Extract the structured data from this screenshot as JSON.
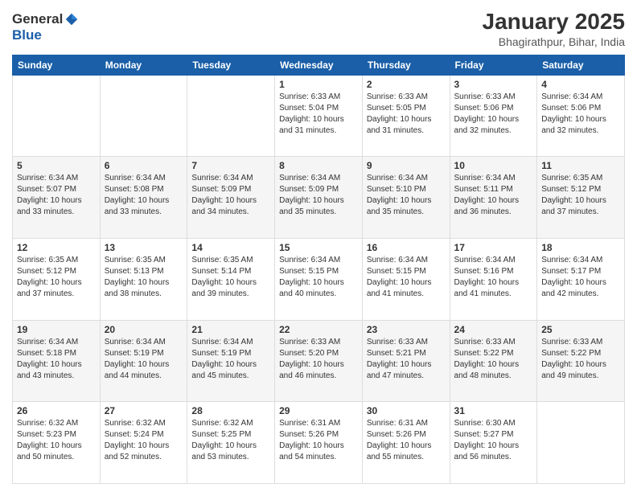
{
  "header": {
    "logo_line1": "General",
    "logo_line2": "Blue",
    "title": "January 2025",
    "subtitle": "Bhagirathpur, Bihar, India"
  },
  "weekdays": [
    "Sunday",
    "Monday",
    "Tuesday",
    "Wednesday",
    "Thursday",
    "Friday",
    "Saturday"
  ],
  "weeks": [
    [
      {
        "num": "",
        "info": ""
      },
      {
        "num": "",
        "info": ""
      },
      {
        "num": "",
        "info": ""
      },
      {
        "num": "1",
        "info": "Sunrise: 6:33 AM\nSunset: 5:04 PM\nDaylight: 10 hours\nand 31 minutes."
      },
      {
        "num": "2",
        "info": "Sunrise: 6:33 AM\nSunset: 5:05 PM\nDaylight: 10 hours\nand 31 minutes."
      },
      {
        "num": "3",
        "info": "Sunrise: 6:33 AM\nSunset: 5:06 PM\nDaylight: 10 hours\nand 32 minutes."
      },
      {
        "num": "4",
        "info": "Sunrise: 6:34 AM\nSunset: 5:06 PM\nDaylight: 10 hours\nand 32 minutes."
      }
    ],
    [
      {
        "num": "5",
        "info": "Sunrise: 6:34 AM\nSunset: 5:07 PM\nDaylight: 10 hours\nand 33 minutes."
      },
      {
        "num": "6",
        "info": "Sunrise: 6:34 AM\nSunset: 5:08 PM\nDaylight: 10 hours\nand 33 minutes."
      },
      {
        "num": "7",
        "info": "Sunrise: 6:34 AM\nSunset: 5:09 PM\nDaylight: 10 hours\nand 34 minutes."
      },
      {
        "num": "8",
        "info": "Sunrise: 6:34 AM\nSunset: 5:09 PM\nDaylight: 10 hours\nand 35 minutes."
      },
      {
        "num": "9",
        "info": "Sunrise: 6:34 AM\nSunset: 5:10 PM\nDaylight: 10 hours\nand 35 minutes."
      },
      {
        "num": "10",
        "info": "Sunrise: 6:34 AM\nSunset: 5:11 PM\nDaylight: 10 hours\nand 36 minutes."
      },
      {
        "num": "11",
        "info": "Sunrise: 6:35 AM\nSunset: 5:12 PM\nDaylight: 10 hours\nand 37 minutes."
      }
    ],
    [
      {
        "num": "12",
        "info": "Sunrise: 6:35 AM\nSunset: 5:12 PM\nDaylight: 10 hours\nand 37 minutes."
      },
      {
        "num": "13",
        "info": "Sunrise: 6:35 AM\nSunset: 5:13 PM\nDaylight: 10 hours\nand 38 minutes."
      },
      {
        "num": "14",
        "info": "Sunrise: 6:35 AM\nSunset: 5:14 PM\nDaylight: 10 hours\nand 39 minutes."
      },
      {
        "num": "15",
        "info": "Sunrise: 6:34 AM\nSunset: 5:15 PM\nDaylight: 10 hours\nand 40 minutes."
      },
      {
        "num": "16",
        "info": "Sunrise: 6:34 AM\nSunset: 5:15 PM\nDaylight: 10 hours\nand 41 minutes."
      },
      {
        "num": "17",
        "info": "Sunrise: 6:34 AM\nSunset: 5:16 PM\nDaylight: 10 hours\nand 41 minutes."
      },
      {
        "num": "18",
        "info": "Sunrise: 6:34 AM\nSunset: 5:17 PM\nDaylight: 10 hours\nand 42 minutes."
      }
    ],
    [
      {
        "num": "19",
        "info": "Sunrise: 6:34 AM\nSunset: 5:18 PM\nDaylight: 10 hours\nand 43 minutes."
      },
      {
        "num": "20",
        "info": "Sunrise: 6:34 AM\nSunset: 5:19 PM\nDaylight: 10 hours\nand 44 minutes."
      },
      {
        "num": "21",
        "info": "Sunrise: 6:34 AM\nSunset: 5:19 PM\nDaylight: 10 hours\nand 45 minutes."
      },
      {
        "num": "22",
        "info": "Sunrise: 6:33 AM\nSunset: 5:20 PM\nDaylight: 10 hours\nand 46 minutes."
      },
      {
        "num": "23",
        "info": "Sunrise: 6:33 AM\nSunset: 5:21 PM\nDaylight: 10 hours\nand 47 minutes."
      },
      {
        "num": "24",
        "info": "Sunrise: 6:33 AM\nSunset: 5:22 PM\nDaylight: 10 hours\nand 48 minutes."
      },
      {
        "num": "25",
        "info": "Sunrise: 6:33 AM\nSunset: 5:22 PM\nDaylight: 10 hours\nand 49 minutes."
      }
    ],
    [
      {
        "num": "26",
        "info": "Sunrise: 6:32 AM\nSunset: 5:23 PM\nDaylight: 10 hours\nand 50 minutes."
      },
      {
        "num": "27",
        "info": "Sunrise: 6:32 AM\nSunset: 5:24 PM\nDaylight: 10 hours\nand 52 minutes."
      },
      {
        "num": "28",
        "info": "Sunrise: 6:32 AM\nSunset: 5:25 PM\nDaylight: 10 hours\nand 53 minutes."
      },
      {
        "num": "29",
        "info": "Sunrise: 6:31 AM\nSunset: 5:26 PM\nDaylight: 10 hours\nand 54 minutes."
      },
      {
        "num": "30",
        "info": "Sunrise: 6:31 AM\nSunset: 5:26 PM\nDaylight: 10 hours\nand 55 minutes."
      },
      {
        "num": "31",
        "info": "Sunrise: 6:30 AM\nSunset: 5:27 PM\nDaylight: 10 hours\nand 56 minutes."
      },
      {
        "num": "",
        "info": ""
      }
    ]
  ]
}
